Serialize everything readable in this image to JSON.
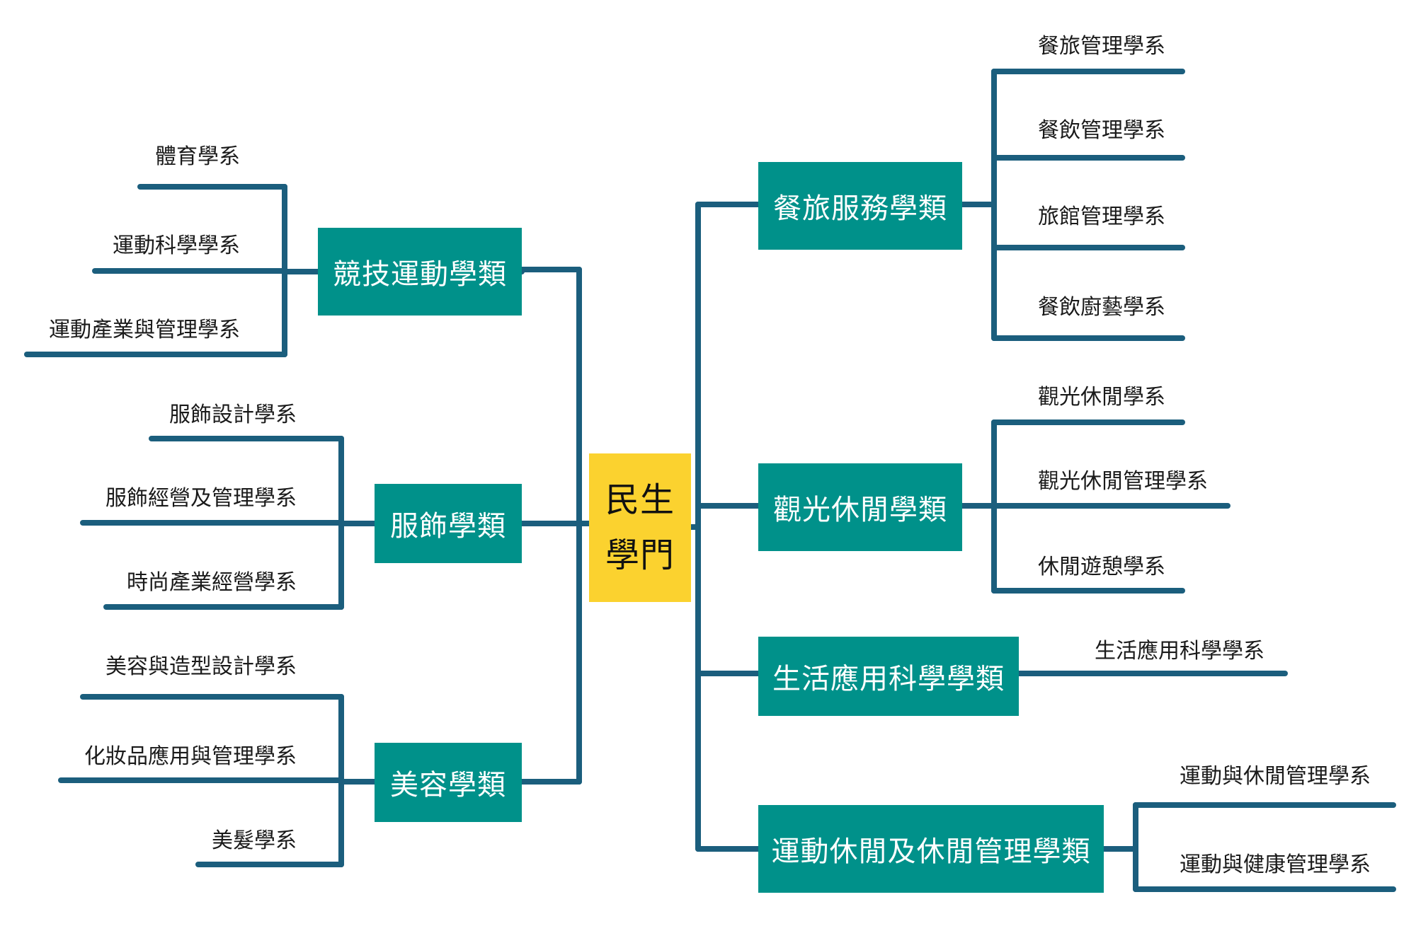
{
  "colors": {
    "line": "#1b5e7d",
    "category": "#00918a",
    "root": "#fbd22f"
  },
  "root": {
    "line1": "民生",
    "line2": "學門"
  },
  "left": [
    {
      "label": "競技運動學類",
      "children": [
        "體育學系",
        "運動科學學系",
        "運動產業與管理學系"
      ]
    },
    {
      "label": "服飾學類",
      "children": [
        "服飾設計學系",
        "服飾經營及管理學系",
        "時尚產業經營學系"
      ]
    },
    {
      "label": "美容學類",
      "children": [
        "美容與造型設計學系",
        "化妝品應用與管理學系",
        "美髮學系"
      ]
    }
  ],
  "right": [
    {
      "label": "餐旅服務學類",
      "children": [
        "餐旅管理學系",
        "餐飲管理學系",
        "旅館管理學系",
        "餐飲廚藝學系"
      ]
    },
    {
      "label": "觀光休閒學類",
      "children": [
        "觀光休閒學系",
        "觀光休閒管理學系",
        "休閒遊憩學系"
      ]
    },
    {
      "label": "生活應用科學學類",
      "children": [
        "生活應用科學學系"
      ]
    },
    {
      "label": "運動休閒及休閒管理學類",
      "children": [
        "運動與休閒管理學系",
        "運動與健康管理學系"
      ]
    }
  ]
}
